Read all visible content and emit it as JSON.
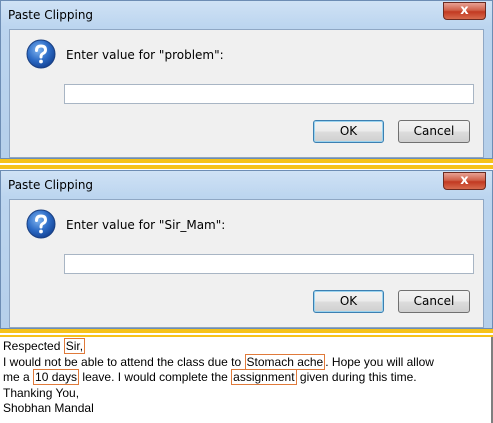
{
  "dialogs": [
    {
      "title": "Paste Clipping",
      "close_glyph": "x",
      "prompt": "Enter value for \"problem\":",
      "input_value": "",
      "ok_label": "OK",
      "cancel_label": "Cancel"
    },
    {
      "title": "Paste Clipping",
      "close_glyph": "x",
      "prompt": "Enter value for \"Sir_Mam\":",
      "input_value": "",
      "ok_label": "OK",
      "cancel_label": "Cancel"
    }
  ],
  "icons": {
    "question": "question-icon"
  },
  "letter": {
    "greeting": "Respected",
    "sir_mam": "Sir,",
    "line2_start": "I would not be able to attend the class due to",
    "problem": "Stomach ache",
    "line2_end": ". Hope you will allow",
    "line3_start": "me a",
    "days": "10 days",
    "line3_mid": "leave. I would complete the",
    "assignment": "assignment",
    "line3_end": "given during this time.",
    "closing": "Thanking You,",
    "name": "Shobhan Mandal"
  },
  "colors": {
    "separator": "#f6c21a",
    "field_outline": "#e07a3a",
    "close_button": "#c23a22"
  }
}
